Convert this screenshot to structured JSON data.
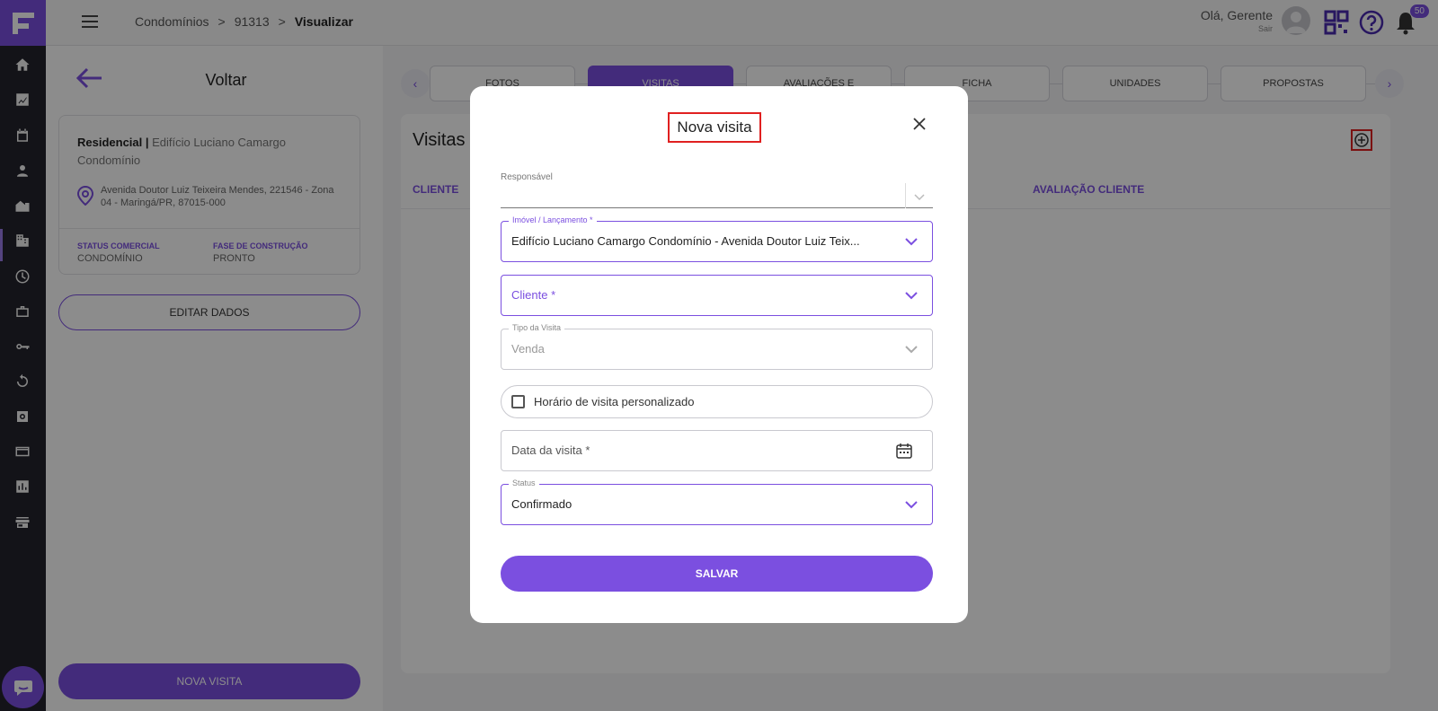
{
  "header": {
    "breadcrumbs": [
      "Condomínios",
      ">",
      "91313",
      ">",
      "Visualizar"
    ],
    "greeting": "Olá, Gerente",
    "logout": "Sair",
    "notif_count": "50"
  },
  "left": {
    "back_label": "Voltar",
    "type_label": "Residencial |",
    "name": "Edifício Luciano Camargo Condomínio",
    "address": "Avenida Doutor Luiz Teixeira Mendes, 221546 - Zona 04 - Maringá/PR, 87015-000",
    "status_label": "STATUS COMERCIAL",
    "status_value": "CONDOMÍNIO",
    "phase_label": "FASE DE CONSTRUÇÃO",
    "phase_value": "PRONTO",
    "edit_button": "EDITAR DADOS",
    "new_visit_button": "NOVA VISITA"
  },
  "tabs": [
    {
      "label": "FOTOS"
    },
    {
      "label": "VISITAS"
    },
    {
      "label": "AVALIAÇÕES E"
    },
    {
      "label": "FICHA"
    },
    {
      "label": "UNIDADES"
    },
    {
      "label": "PROPOSTAS"
    }
  ],
  "visits": {
    "title": "Visitas",
    "col_client": "CLIENTE",
    "col_rating": "AVALIAÇÃO CLIENTE"
  },
  "modal": {
    "title": "Nova visita",
    "responsavel_label": "Responsável",
    "imovel_label": "Imóvel / Lançamento *",
    "imovel_value": "Edifício Luciano Camargo Condomínio - Avenida Doutor Luiz Teix...",
    "cliente_placeholder": "Cliente *",
    "tipo_label": "Tipo da Visita",
    "tipo_value": "Venda",
    "custom_time_label": "Horário de visita personalizado",
    "date_placeholder": "Data da visita *",
    "status_label": "Status",
    "status_value": "Confirmado",
    "save_button": "SALVAR"
  },
  "colors": {
    "accent": "#7b4fe0",
    "rail": "#24242c",
    "highlight_border": "#e02020"
  }
}
